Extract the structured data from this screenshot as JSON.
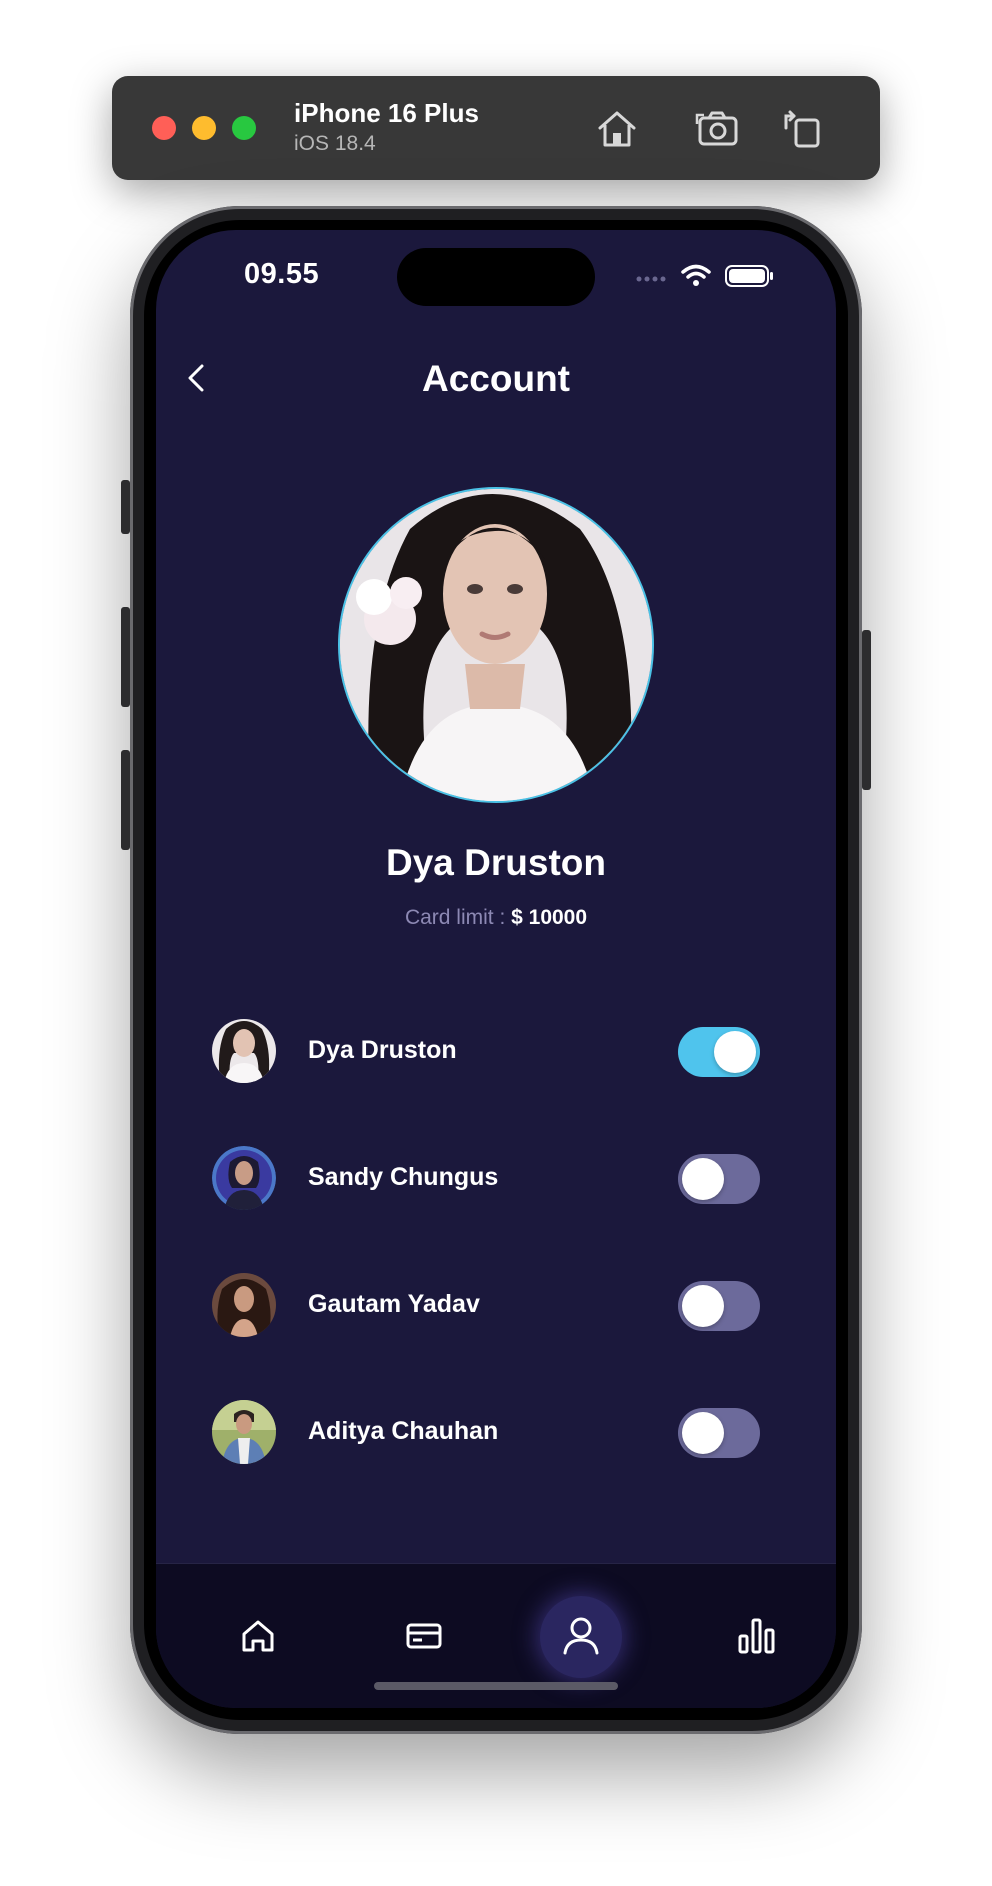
{
  "simulator": {
    "device_name": "iPhone 16 Plus",
    "os_version": "iOS 18.4"
  },
  "status_bar": {
    "time": "09.55"
  },
  "header": {
    "title": "Account"
  },
  "profile": {
    "name": "Dya Druston",
    "card_limit_label": "Card limit : ",
    "card_limit_value": "$ 10000"
  },
  "accounts": [
    {
      "name": "Dya Druston",
      "enabled": true
    },
    {
      "name": "Sandy Chungus",
      "enabled": false
    },
    {
      "name": "Gautam Yadav",
      "enabled": false
    },
    {
      "name": "Aditya Chauhan",
      "enabled": false
    }
  ],
  "bottom_nav": {
    "items": [
      {
        "icon": "home-icon",
        "active": false
      },
      {
        "icon": "card-icon",
        "active": false
      },
      {
        "icon": "user-icon",
        "active": true
      },
      {
        "icon": "bar-chart-icon",
        "active": false
      }
    ]
  },
  "colors": {
    "background": "#1b183c",
    "toggle_on": "#4fc4ed",
    "toggle_off": "#6c6a9b",
    "nav_background": "#0d0b22"
  }
}
